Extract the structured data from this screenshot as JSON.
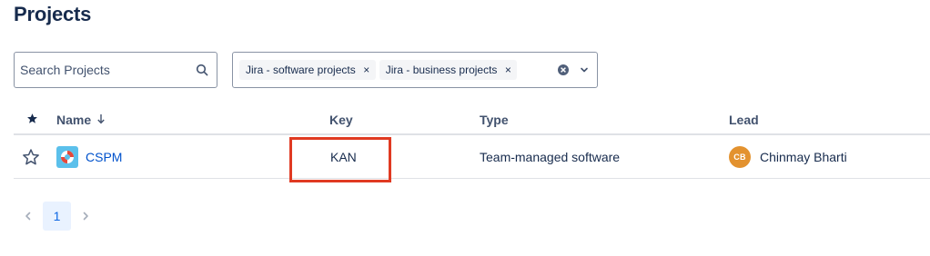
{
  "page": {
    "title": "Projects"
  },
  "search": {
    "placeholder": "Search Projects"
  },
  "filter": {
    "chips": [
      {
        "label": "Jira - software projects"
      },
      {
        "label": "Jira - business projects"
      }
    ],
    "chip_remove_glyph": "×"
  },
  "table": {
    "headers": {
      "star": "★",
      "name": "Name",
      "key": "Key",
      "type": "Type",
      "lead": "Lead"
    },
    "rows": [
      {
        "name": "CSPM",
        "key": "KAN",
        "type": "Team-managed software",
        "lead": {
          "name": "Chinmay Bharti",
          "initials": "CB"
        }
      }
    ]
  },
  "pagination": {
    "current_page": "1"
  },
  "colors": {
    "text": "#172B4D",
    "link": "#0052CC",
    "highlight": "#E03A22",
    "lead_avatar": "#E3922F",
    "project_avatar": "#5BC0EB",
    "page_active_bg": "#E9F2FF"
  },
  "icons": [
    "search-icon",
    "clear-icon",
    "chevron-down-icon",
    "star-icon",
    "arrow-down-icon",
    "project-avatar-icon",
    "chevron-left-icon",
    "chevron-right-icon"
  ]
}
